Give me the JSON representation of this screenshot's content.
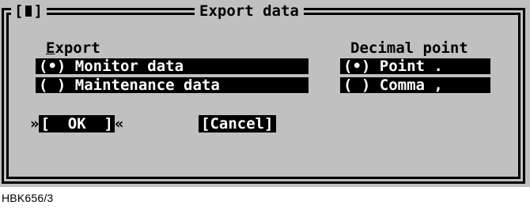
{
  "dialog": {
    "title": "Export data",
    "close_box": "[",
    "close_box_end": "]"
  },
  "export_group": {
    "hotkey": "E",
    "label_rest": "xport",
    "options": [
      {
        "marker": "(•)",
        "label": "Monitor data",
        "selected": true
      },
      {
        "marker": "( )",
        "label": "Maintenance data",
        "selected": false
      }
    ]
  },
  "decimal_group": {
    "label": "Decimal point",
    "options": [
      {
        "marker": "(•)",
        "label": "Point .",
        "selected": true
      },
      {
        "marker": "( )",
        "label": "Comma ,",
        "selected": false
      }
    ]
  },
  "buttons": {
    "focus_left": "»",
    "focus_right": "«",
    "ok_label": "[  OK  ]",
    "cancel_label": "[Cancel]"
  },
  "figure_code": "HBK656/3"
}
